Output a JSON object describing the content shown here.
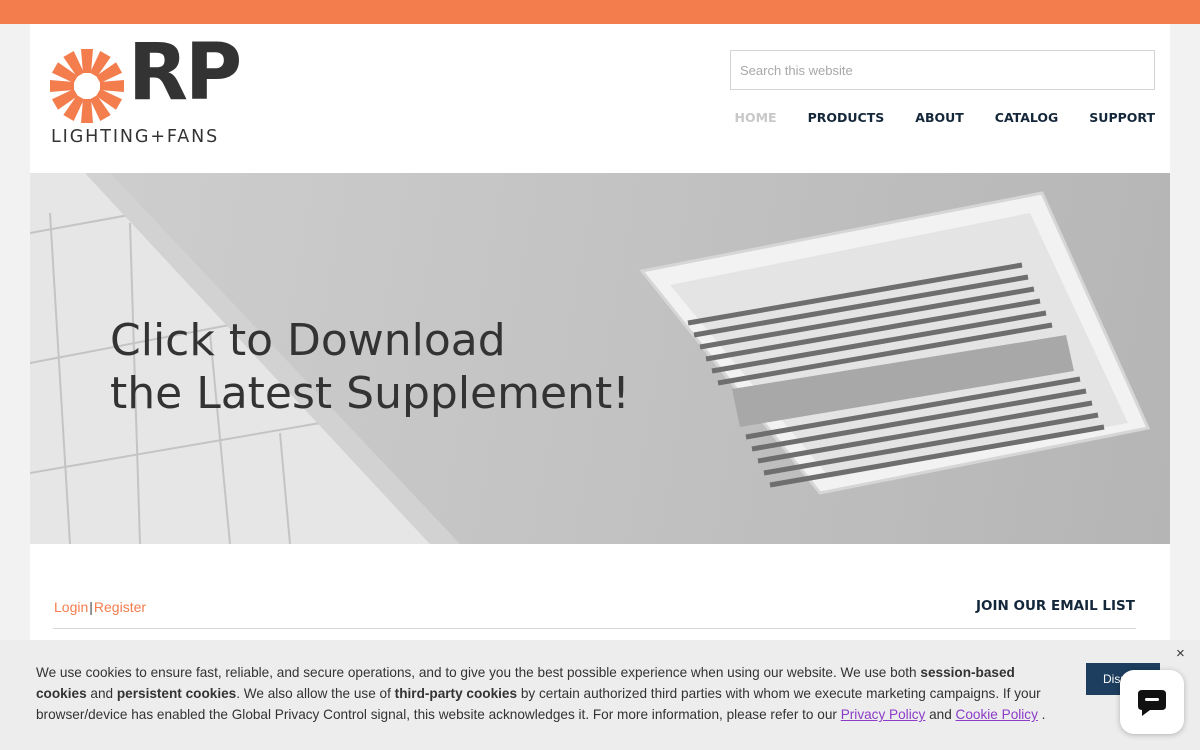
{
  "brand": {
    "letters": "RP",
    "tagline": "LIGHTING+FANS",
    "accent_color": "#f47d4e",
    "dark_color": "#333333"
  },
  "search": {
    "placeholder": "Search this website"
  },
  "nav": {
    "items": [
      {
        "label": "HOME",
        "active": true
      },
      {
        "label": "PRODUCTS",
        "active": false
      },
      {
        "label": "ABOUT",
        "active": false
      },
      {
        "label": "CATALOG",
        "active": false
      },
      {
        "label": "SUPPORT",
        "active": false
      }
    ]
  },
  "hero": {
    "line1": "Click to Download",
    "line2": "the Latest Supplement!"
  },
  "account": {
    "login": "Login",
    "separator": "|",
    "register": "Register"
  },
  "email_list": {
    "label": "JOIN OUR EMAIL LIST"
  },
  "cookie": {
    "t1": "We use cookies to ensure fast, reliable, and secure operations, and to give you the best possible experience when using our website. We use both ",
    "b1": "session-based cookies",
    "t2": " and ",
    "b2": "persistent cookies",
    "t3": ". We also allow the use of ",
    "b3": "third-party cookies",
    "t4": " by certain authorized third parties with whom we execute marketing campaigns. If your browser/device has enabled the Global Privacy Control signal, this website acknowledges it. For more information, please refer to our ",
    "privacy_link": "Privacy Policy",
    "t5": " and ",
    "cookie_link": "Cookie Policy",
    "t6": " .",
    "dismiss_label": "Dismiss",
    "close_label": "×",
    "link_color": "#8c3cc8",
    "button_color": "#1d3e5e"
  },
  "chat": {
    "icon": "chat-bubble-icon"
  }
}
